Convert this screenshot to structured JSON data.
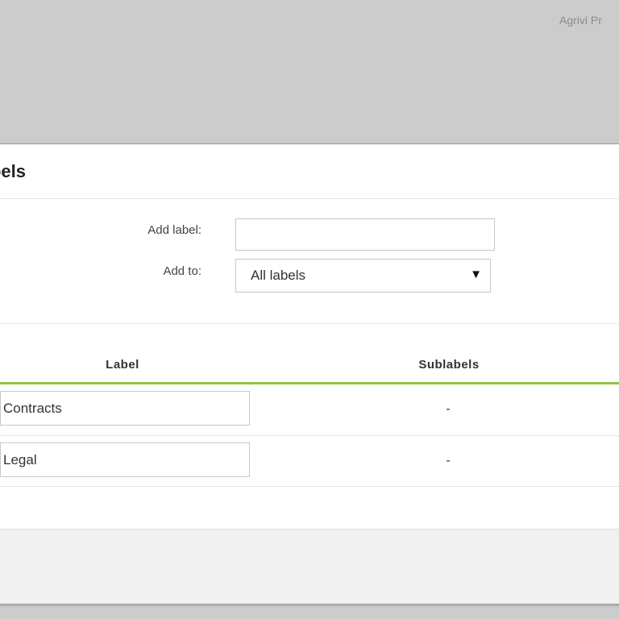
{
  "header": {
    "brand_text": "Agrivi Pr"
  },
  "dialog": {
    "title": "Labels",
    "title_visible": "els",
    "form": {
      "add_label_text": "Add label:",
      "add_label_value": "",
      "add_to_text": "Add to:",
      "add_to_selected": "All labels",
      "dropdown_arrow": "▼"
    },
    "table": {
      "columns": [
        "Label",
        "Sublabels"
      ],
      "rows": [
        {
          "label": "Contracts",
          "sublabels": "-"
        },
        {
          "label": "Legal",
          "sublabels": "-"
        }
      ]
    }
  }
}
